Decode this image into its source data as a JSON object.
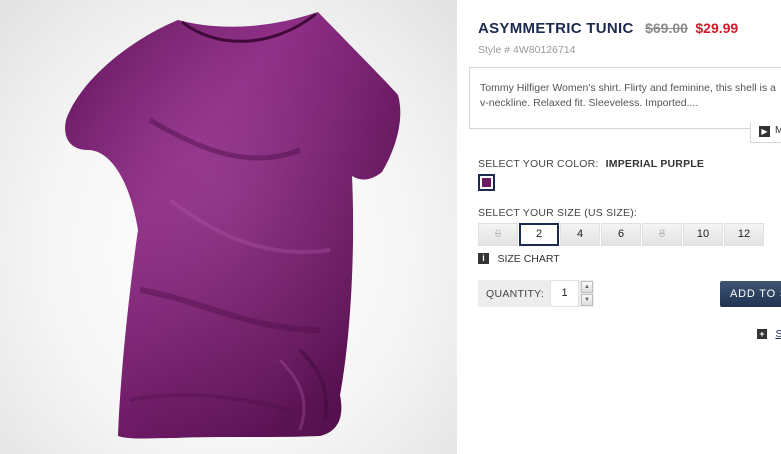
{
  "product": {
    "title": "ASYMMETRIC TUNIC",
    "old_price": "$69.00",
    "sale_price": "$29.99",
    "style_number": "Style # 4W80126714",
    "description": "Tommy Hilfiger Women's shirt. Flirty and feminine, this shell is a",
    "description_line2": "v-neckline. Relaxed fit. Sleeveless. Imported....",
    "more_label": "M",
    "image_icon": "purple-tunic-photo"
  },
  "color": {
    "label": "SELECT YOUR COLOR:",
    "value": "IMPERIAL PURPLE",
    "swatch_hex": "#6b1a63"
  },
  "size": {
    "label": "SELECT YOUR SIZE (US SIZE):",
    "options": [
      {
        "label": "0",
        "available": false,
        "selected": false
      },
      {
        "label": "2",
        "available": true,
        "selected": true
      },
      {
        "label": "4",
        "available": true,
        "selected": false
      },
      {
        "label": "6",
        "available": true,
        "selected": false
      },
      {
        "label": "8",
        "available": false,
        "selected": false
      },
      {
        "label": "10",
        "available": true,
        "selected": false
      },
      {
        "label": "12",
        "available": true,
        "selected": false
      }
    ],
    "chart_label": "SIZE CHART",
    "chart_icon": "info-icon"
  },
  "quantity": {
    "label": "QUANTITY:",
    "value": "1"
  },
  "actions": {
    "add_label": "ADD TO S",
    "save_label": "S"
  },
  "colors": {
    "brand_navy": "#1c2a4f",
    "sale_red": "#d11a2a",
    "garment_purple": "#6b1a63"
  }
}
